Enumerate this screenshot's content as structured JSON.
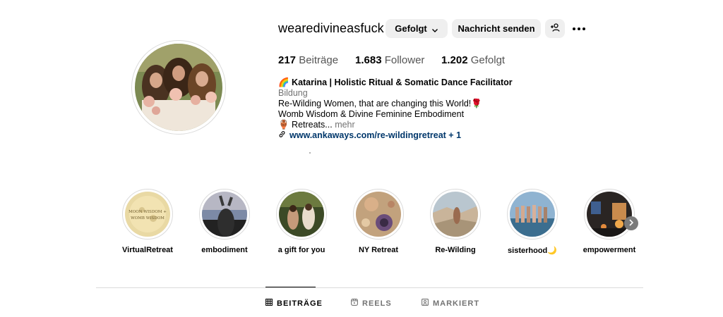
{
  "profile": {
    "username": "wearedivineasfuck",
    "follow_label": "Gefolgt",
    "message_label": "Nachricht senden",
    "stats": {
      "posts_count": "217",
      "posts_label": "Beiträge",
      "followers_count": "1.683",
      "followers_label": "Follower",
      "following_count": "1.202",
      "following_label": "Gefolgt"
    },
    "bio": {
      "name": "🌈 Katarina | Holistic Ritual & Somatic Dance Facilitator",
      "category": "Bildung",
      "line1": "Re-Wilding Women, that are changing this World!🌹",
      "line2": "Womb Wisdom & Divine Feminine Embodiment",
      "line3": "🏺 Retreats...",
      "more": "mehr",
      "link": "www.ankaways.com/re-wildingretreat + 1"
    }
  },
  "highlights": [
    {
      "label": "VirtualRetreat",
      "caption": "Moon Wisdom + Womb Wisdom"
    },
    {
      "label": "embodiment"
    },
    {
      "label": "a gift for you"
    },
    {
      "label": "NY Retreat"
    },
    {
      "label": "Re-Wilding"
    },
    {
      "label": "sisterhood🌙"
    },
    {
      "label": "empowerment"
    }
  ],
  "tabs": [
    {
      "label": "BEITRÄGE",
      "icon": "grid-icon"
    },
    {
      "label": "REELS",
      "icon": "reels-icon"
    },
    {
      "label": "MARKIERT",
      "icon": "tagged-icon"
    }
  ],
  "colors": {
    "link": "#00376b",
    "muted": "#737373",
    "button_bg": "#efefef",
    "border": "#dbdbdb"
  }
}
